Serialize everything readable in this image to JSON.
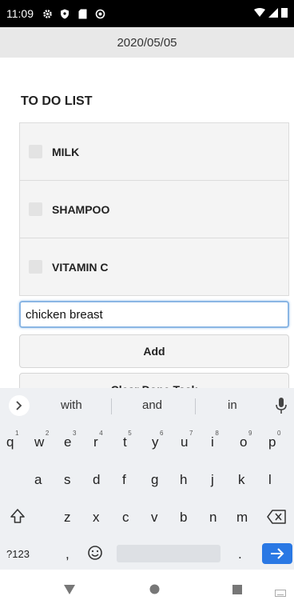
{
  "status_bar": {
    "time": "11:09",
    "icons": [
      "settings-icon",
      "shield-icon",
      "sd-card-icon",
      "sync-icon"
    ],
    "right_icons": [
      "wifi-icon",
      "signal-icon",
      "battery-icon"
    ]
  },
  "header": {
    "date": "2020/05/05"
  },
  "todo": {
    "title": "TO DO LIST",
    "items": [
      {
        "label": "MILK",
        "checked": false
      },
      {
        "label": "SHAMPOO",
        "checked": false
      },
      {
        "label": "VITAMIN C",
        "checked": false
      }
    ]
  },
  "input": {
    "value": "chicken breast"
  },
  "buttons": {
    "add": "Add",
    "clear": "Clear Done Task"
  },
  "keyboard": {
    "suggestions": [
      "with",
      "and",
      "in"
    ],
    "row1": [
      {
        "k": "q",
        "n": "1"
      },
      {
        "k": "w",
        "n": "2"
      },
      {
        "k": "e",
        "n": "3"
      },
      {
        "k": "r",
        "n": "4"
      },
      {
        "k": "t",
        "n": "5"
      },
      {
        "k": "y",
        "n": "6"
      },
      {
        "k": "u",
        "n": "7"
      },
      {
        "k": "i",
        "n": "8"
      },
      {
        "k": "o",
        "n": "9"
      },
      {
        "k": "p",
        "n": "0"
      }
    ],
    "row2": [
      "a",
      "s",
      "d",
      "f",
      "g",
      "h",
      "j",
      "k",
      "l"
    ],
    "row3": [
      "z",
      "x",
      "c",
      "v",
      "b",
      "n",
      "m"
    ],
    "symbols_label": "?123",
    "comma": ",",
    "period": "."
  },
  "colors": {
    "accent": "#2a78e4",
    "header_bg": "#e8e8e8",
    "input_border": "#8ab6e4"
  }
}
